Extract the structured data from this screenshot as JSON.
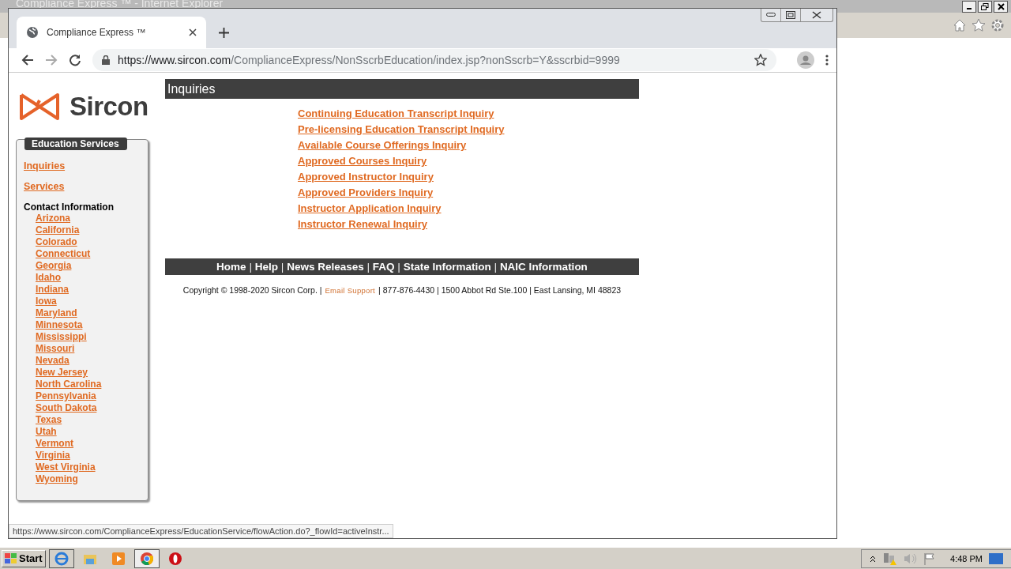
{
  "background_window": {
    "title": "Compliance Express ™ - Internet Explorer"
  },
  "browser": {
    "tab": {
      "title": "Compliance Express ™",
      "selected": true
    },
    "url_host": "https://www.sircon.com",
    "url_path": "/ComplianceExpress/NonSscrbEducation/index.jsp?nonSscrb=Y&sscrbid=9999"
  },
  "logo": "Sircon",
  "sidebar": {
    "title": "Education Services",
    "links": [
      "Inquiries",
      "Services"
    ],
    "contact_heading": "Contact Information",
    "states": [
      "Arizona",
      "California",
      "Colorado",
      "Connecticut",
      "Georgia",
      "Idaho",
      "Indiana",
      "Iowa",
      "Maryland",
      "Minnesota",
      "Mississippi",
      "Missouri",
      "Nevada",
      "New Jersey",
      "North Carolina",
      "Pennsylvania",
      "South Dakota",
      "Texas",
      "Utah",
      "Vermont",
      "Virginia",
      "West Virginia",
      "Wyoming"
    ]
  },
  "main": {
    "title": "Inquiries",
    "links": [
      "Continuing Education Transcript Inquiry",
      "Pre-licensing Education Transcript Inquiry",
      "Available Course Offerings Inquiry",
      "Approved Courses Inquiry",
      "Approved Instructor Inquiry",
      "Approved Providers Inquiry",
      "Instructor Application Inquiry",
      "Instructor Renewal Inquiry"
    ]
  },
  "footer_nav": {
    "separator": "|",
    "links": [
      "Home",
      "Help",
      "News Releases",
      "FAQ",
      "State Information",
      "NAIC Information"
    ]
  },
  "copyright": {
    "before": "Copyright © 1998-2020 Sircon Corp. |",
    "link": "Email Support",
    "after": "| 877-876-4430 | 1500 Abbot Rd Ste.100 | East Lansing, MI 48823"
  },
  "status_url": "https://www.sircon.com/ComplianceExpress/EducationService/flowAction.do?_flowId=activeInstr...",
  "taskbar": {
    "start": "Start",
    "clock": "4:48 PM"
  }
}
